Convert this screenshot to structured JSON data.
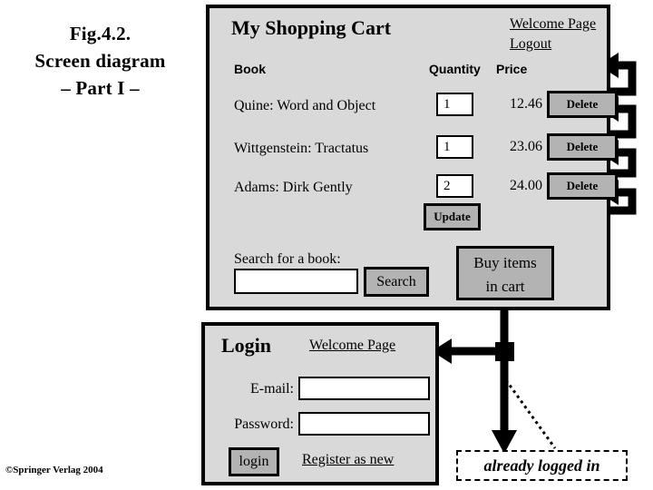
{
  "figure": {
    "caption_lines": [
      "Fig.4.2.",
      "Screen diagram",
      "– Part I –"
    ],
    "copyright": "©Springer Verlag 2004"
  },
  "cart_screen": {
    "title": "My Shopping Cart",
    "welcome_link": "Welcome Page",
    "logout_link": "Logout",
    "columns": {
      "book": "Book",
      "quantity": "Quantity",
      "price": "Price"
    },
    "rows": [
      {
        "book": "Quine: Word and Object",
        "quantity": "1",
        "price": "12.46",
        "delete_label": "Delete"
      },
      {
        "book": "Wittgenstein: Tractatus",
        "quantity": "1",
        "price": "23.06",
        "delete_label": "Delete"
      },
      {
        "book": "Adams: Dirk Gently",
        "quantity": "2",
        "price": "24.00",
        "delete_label": "Delete"
      }
    ],
    "update_label": "Update",
    "buy_label_line1": "Buy items",
    "buy_label_line2": "in cart",
    "search_label": "Search for a book:",
    "search_value": "",
    "search_button_label": "Search"
  },
  "login_screen": {
    "title": "Login",
    "welcome_link": "Welcome Page",
    "email_label": "E-mail:",
    "email_value": "",
    "password_label": "Password:",
    "password_value": "",
    "login_button_label": "login",
    "register_link": "Register as new"
  },
  "annotation": {
    "text": "already logged in"
  },
  "colors": {
    "panel_background": "#d9d9d9",
    "button_face": "#b3b3b3",
    "stroke": "#000000",
    "field_background": "#ffffff",
    "page_background": "#ffffff"
  }
}
